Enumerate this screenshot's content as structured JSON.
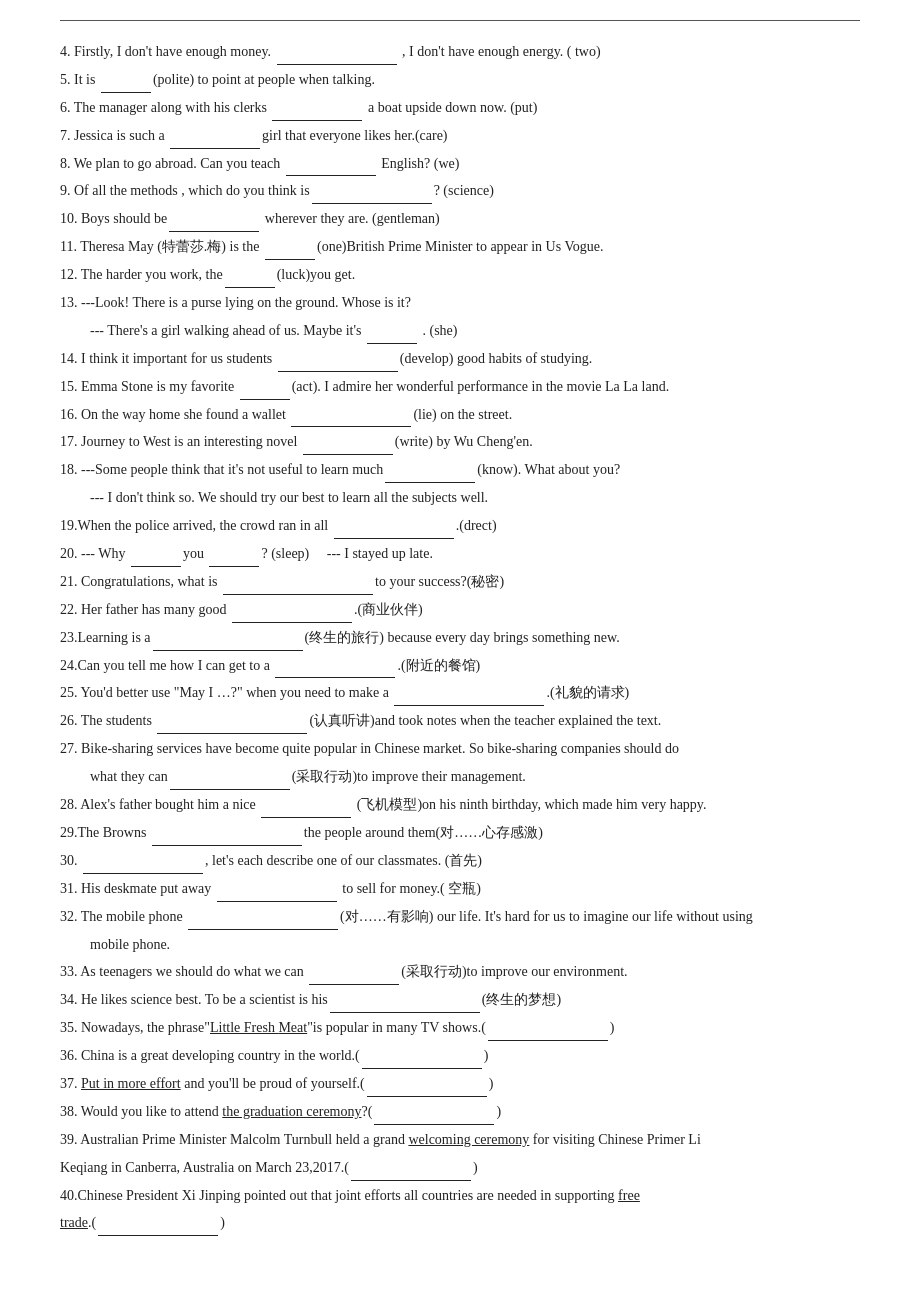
{
  "items": [
    {
      "num": "4.",
      "text": "Firstly, I don't have enough money. ____________ , I don't have enough energy. ( two)"
    },
    {
      "num": "5.",
      "text": "It is _________(polite) to point at people when talking."
    },
    {
      "num": "6.",
      "text": "The manager along with his clerks __________ a boat upside down now. (put)"
    },
    {
      "num": "7.",
      "text": "Jessica is such a ____________girl that everyone likes her.(care)"
    },
    {
      "num": "8.",
      "text": "We plan to go abroad. Can you teach __________ English? (we)"
    },
    {
      "num": "9.",
      "text": "Of all the methods , which do you think is______________? (science)"
    },
    {
      "num": "10.",
      "text": "Boys should be__________ wherever they are. (gentleman)"
    },
    {
      "num": "11.",
      "text": "Theresa May (特蕾莎.梅) is the ________(one)British Prime Minister to appear in Us Vogue."
    },
    {
      "num": "12.",
      "text": "The harder you work, the_________(luck)you get."
    },
    {
      "num": "13.",
      "text": "---Look! There is a purse lying on the ground. Whose is it?"
    },
    {
      "num": "13_indent",
      "text": "--- There's a girl walking ahead of us. Maybe it's ________ . (she)"
    },
    {
      "num": "14.",
      "text": "I think it important for us students ___________(develop) good habits of studying."
    },
    {
      "num": "15.",
      "text": "Emma Stone is my favorite _______(act). I admire her wonderful performance in the movie La La land."
    },
    {
      "num": "16.",
      "text": "On the way home she found a wallet ____________(lie) on the street."
    },
    {
      "num": "17.",
      "text": "Journey to West is an interesting novel ________(write) by Wu Cheng'en."
    },
    {
      "num": "18.",
      "text": "---Some people think that it's not useful to learn much__________(know). What about you?"
    },
    {
      "num": "18_indent",
      "text": "--- I don't think so. We should try our best to learn all the subjects well."
    },
    {
      "num": "19.",
      "text": "When the police arrived, the crowd ran in all ____________.(drect)"
    },
    {
      "num": "20.",
      "text": "--- Why _______you _________? (sleep)    --- I stayed up late."
    },
    {
      "num": "21.",
      "text": "Congratulations, what is ________________to your success?(秘密)"
    },
    {
      "num": "22.",
      "text": "Her father has many good ____________.(商业伙伴)"
    },
    {
      "num": "23.",
      "text": "Learning is a______________(终生的旅行) because every day brings something new."
    },
    {
      "num": "24.",
      "text": "Can you tell me how I can get to a ____________.(附近的餐馆)"
    },
    {
      "num": "25.",
      "text": "You'd better use \"May I …?\" when you need to make a _____________.(礼貌的请求)"
    },
    {
      "num": "26.",
      "text": "The students ______________(认真听讲)and took notes when the teacher explained the text."
    },
    {
      "num": "27.",
      "text": "Bike-sharing services have become quite popular in Chinese market. So bike-sharing companies should do"
    },
    {
      "num": "27_indent",
      "text": "what they can____________(采取行动)to improve their management."
    },
    {
      "num": "28.",
      "text": "Alex's father bought him a nice _______ (飞机模型)on his ninth birthday, which made him very happy."
    },
    {
      "num": "29.",
      "text": "The Browns ________________the people around them(对……心存感激)"
    },
    {
      "num": "30.",
      "text": "___________, let's each describe one of our classmates. (首先)"
    },
    {
      "num": "31.",
      "text": "His deskmate put away ____________ to sell for money.( 空瓶)"
    },
    {
      "num": "32.",
      "text": "The mobile phone ______________(对……有影响) our life. It's hard for us to imagine our life without using"
    },
    {
      "num": "32_indent",
      "text": "mobile phone."
    },
    {
      "num": "33.",
      "text": "As teenagers we should do what we can __________(采取行动)to improve our environment."
    },
    {
      "num": "34.",
      "text": "He likes science best. To be a scientist is his_________________(终生的梦想)"
    },
    {
      "num": "35.",
      "text": "Nowadays, the phrase\"Little Fresh Meat\"is popular in many TV shows.(                )"
    },
    {
      "num": "36.",
      "text": "China is a great developing country in the world.(                )"
    },
    {
      "num": "37.",
      "text": "Put in more effort and you'll be proud of yourself.(                )"
    },
    {
      "num": "38.",
      "text": "Would you like to attend the graduation ceremony?(                )"
    },
    {
      "num": "39.",
      "text": "Australian Prime Minister Malcolm Turnbull held a grand welcoming ceremony for visiting Chinese Primer Li"
    },
    {
      "num": "39_b",
      "text": "Keqiang in Canberra, Australia on March 23,2017.(                )"
    },
    {
      "num": "40.",
      "text": "Chinese President Xi Jinping pointed out that joint efforts all countries are needed in supporting free"
    },
    {
      "num": "40_b",
      "text": "trade.(              )"
    }
  ]
}
